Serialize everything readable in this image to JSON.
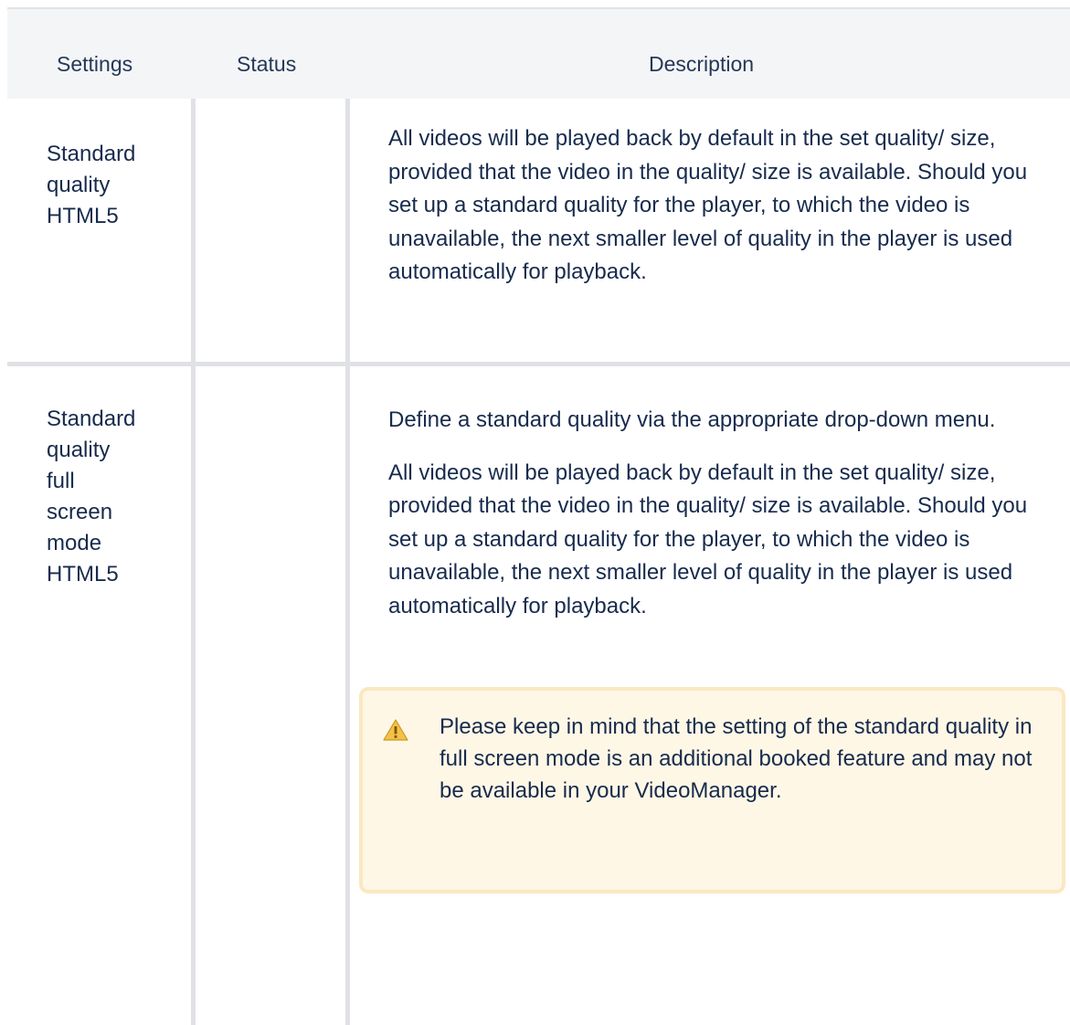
{
  "table": {
    "headers": {
      "settings": "Settings",
      "status": "Status",
      "description": "Description"
    },
    "rows": [
      {
        "setting_lines": [
          "Standard",
          "quality",
          "HTML5"
        ],
        "status": "",
        "description": [
          "All videos will be played back by default in the set quality/ size, provided that the video in the quality/ size is available. Should you set up a standard quality for the player, to which the video is unavailable, the next smaller level of quality in the player is used automatically for playback."
        ]
      },
      {
        "setting_lines": [
          "Standard",
          "quality",
          "full",
          "screen",
          "mode",
          "HTML5"
        ],
        "status": "",
        "description": [
          "Define a standard quality via the appropriate drop-down menu.",
          "All videos will be played back by default in the set quality/ size, provided that the video in the quality/ size is available. Should you set up a standard quality for the player, to which the video is unavailable, the next smaller level of quality in the player is used automatically for playback."
        ],
        "note": {
          "icon": "warning-icon",
          "text": "Please keep in mind that the setting of the standard quality in full screen mode is an additional booked feature and may not be available in your VideoManager."
        }
      }
    ]
  },
  "colors": {
    "header_bg": "#f4f5f7",
    "border": "#dfe1e5",
    "note_bg": "#fff7e6",
    "note_border": "#fbe8c1",
    "warning": "#f5a623"
  }
}
